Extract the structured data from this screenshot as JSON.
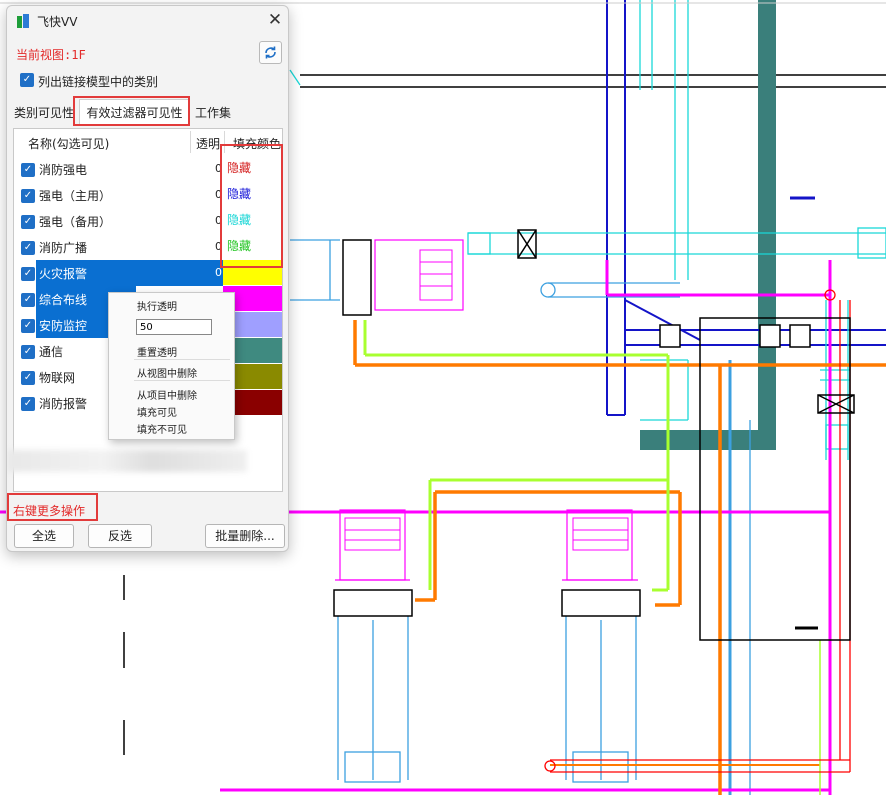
{
  "window": {
    "title": "飞快VV",
    "close_glyph": "✕"
  },
  "current_view": "当前视图:1F",
  "link_models": {
    "label": "列出链接模型中的类别",
    "checked": true
  },
  "tabs": [
    {
      "label": "类别可见性",
      "active": false
    },
    {
      "label": "有效过滤器可见性",
      "active": true
    },
    {
      "label": "工作集",
      "active": false
    }
  ],
  "table": {
    "headers": {
      "name": "名称(勾选可见)",
      "transparency": "透明",
      "fill": "填充颜色"
    },
    "rows": [
      {
        "name": "消防强电",
        "transparency": "0",
        "fill_text": "隐藏",
        "fill_text_color": "#d42020",
        "fill_color": "#ffffff",
        "checked": true,
        "selected": false
      },
      {
        "name": "强电（主用）",
        "transparency": "0",
        "fill_text": "隐藏",
        "fill_text_color": "#1a1ad8",
        "fill_color": "#ffffff",
        "checked": true,
        "selected": false
      },
      {
        "name": "强电（备用）",
        "transparency": "0",
        "fill_text": "隐藏",
        "fill_text_color": "#19d6d6",
        "fill_color": "#ffffff",
        "checked": true,
        "selected": false
      },
      {
        "name": "消防广播",
        "transparency": "0",
        "fill_text": "隐藏",
        "fill_text_color": "#22c522",
        "fill_color": "#ffffff",
        "checked": true,
        "selected": false
      },
      {
        "name": "火灾报警",
        "transparency": "0",
        "fill_text": "",
        "fill_text_color": "",
        "fill_color": "#ffff00",
        "checked": true,
        "selected": true
      },
      {
        "name": "综合布线",
        "transparency": "",
        "fill_text": "",
        "fill_text_color": "",
        "fill_color": "#ff00ff",
        "checked": true,
        "selected": true
      },
      {
        "name": "安防监控",
        "transparency": "",
        "fill_text": "",
        "fill_text_color": "",
        "fill_color": "#9f9fff",
        "checked": true,
        "selected": true
      },
      {
        "name": "通信",
        "transparency": "",
        "fill_text": "",
        "fill_text_color": "",
        "fill_color": "#3f8a80",
        "checked": true,
        "selected": false
      },
      {
        "name": "物联网",
        "transparency": "",
        "fill_text": "",
        "fill_text_color": "",
        "fill_color": "#8a8a00",
        "checked": true,
        "selected": false
      },
      {
        "name": "消防报警",
        "transparency": "",
        "fill_text": "",
        "fill_text_color": "",
        "fill_color": "#8a0000",
        "checked": true,
        "selected": false
      }
    ]
  },
  "context_menu": {
    "items": [
      "执行透明",
      "重置透明",
      "从视图中删除",
      "从项目中删除",
      "填充可见",
      "填充不可见"
    ],
    "transparency_value": "50"
  },
  "footer": {
    "hint": "右键更多操作",
    "buttons": {
      "select_all": "全选",
      "invert": "反选",
      "batch_delete": "批量删除..."
    }
  },
  "cad": {
    "note_text": "---",
    "colors": {
      "teal": "#3a7f7b",
      "magenta": "#ff00ff",
      "orange": "#ff7a00",
      "blue": "#1414c8",
      "cyan": "#19d8d8",
      "lime": "#a8ff30",
      "red": "#ff0000",
      "skyblue": "#3ca0e0",
      "black": "#000000"
    }
  }
}
